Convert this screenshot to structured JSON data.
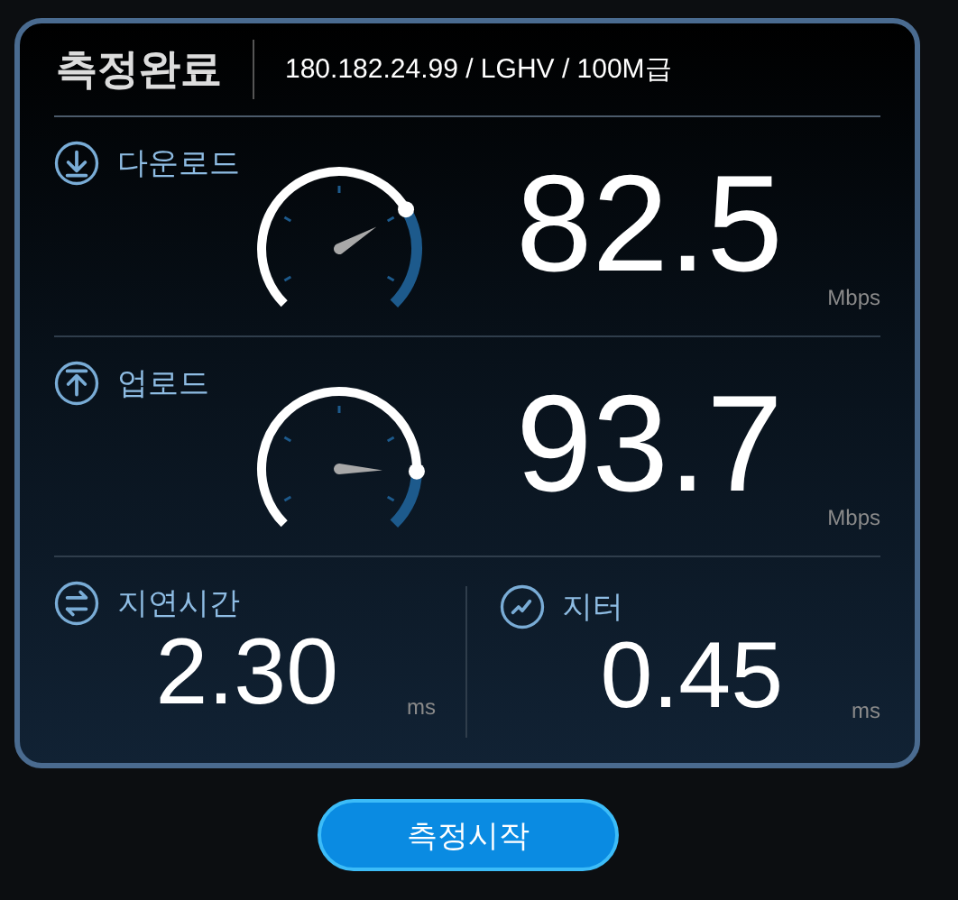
{
  "header": {
    "title": "측정완료",
    "info": "180.182.24.99 / LGHV / 100M급"
  },
  "speeds": [
    {
      "kind": "download",
      "label": "다운로드",
      "value": "82.5",
      "unit": "Mbps"
    },
    {
      "kind": "upload",
      "label": "업로드",
      "value": "93.7",
      "unit": "Mbps"
    }
  ],
  "metrics": [
    {
      "kind": "latency",
      "label": "지연시간",
      "value": "2.30",
      "unit": "ms"
    },
    {
      "kind": "jitter",
      "label": "지터",
      "value": "0.45",
      "unit": "ms"
    }
  ],
  "button": {
    "label": "측정시작"
  }
}
